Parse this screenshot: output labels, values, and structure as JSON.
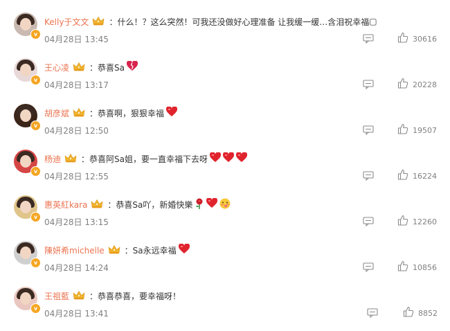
{
  "comments": [
    {
      "user": "Kelly于文文",
      "text": "：什么！？这么突然！可我还没做好心理准备 让我缓一缓…含泪祝幸福",
      "trail": "▢",
      "time": "04月28日 13:45",
      "likes": "30616",
      "emojis": [],
      "avatar_bg": "#c9b9b0"
    },
    {
      "user": "王心凌",
      "text": "：恭喜Sa",
      "trail": "",
      "time": "04月28日 13:17",
      "likes": "20228",
      "emojis": [
        "broken-heart-emoji"
      ],
      "avatar_bg": "#e8d8d8"
    },
    {
      "user": "胡彦斌",
      "text": "：恭喜啊，狠狠幸福",
      "trail": "",
      "time": "04月28日 12:50",
      "likes": "19507",
      "emojis": [
        "heart-emoji"
      ],
      "avatar_bg": "#3b2418"
    },
    {
      "user": "杨迪",
      "text": "：恭喜阿Sa姐，要一直幸福下去呀",
      "trail": "",
      "time": "04月28日 12:55",
      "likes": "16224",
      "emojis": [
        "heart-emoji",
        "heart-emoji",
        "heart-emoji"
      ],
      "avatar_bg": "#d64545"
    },
    {
      "user": "惠英紅kara",
      "text": "：恭喜Sa吖，新婚快樂",
      "trail": "",
      "time": "04月28日 13:15",
      "likes": "12260",
      "emojis": [
        "rose-emoji",
        "heart-emoji",
        "blush-face-emoji"
      ],
      "avatar_bg": "#e0c58a"
    },
    {
      "user": "陳妍希michelle",
      "text": "：Sa永远幸福",
      "trail": "",
      "time": "04月28日 14:24",
      "likes": "10856",
      "emojis": [
        "heart-emoji"
      ],
      "avatar_bg": "#cfcfcf"
    },
    {
      "user": "王祖藍",
      "text": "：恭喜恭喜，要幸福呀！",
      "trail": "",
      "time": "04月28日 13:41",
      "likes": "8852",
      "emojis": [],
      "avatar_bg": "#e9c7c0"
    }
  ],
  "colors": {
    "username": "#eb7350",
    "text": "#333333",
    "meta": "#808080",
    "heart": "#e0242e",
    "vip_badge": "#f5a623"
  }
}
